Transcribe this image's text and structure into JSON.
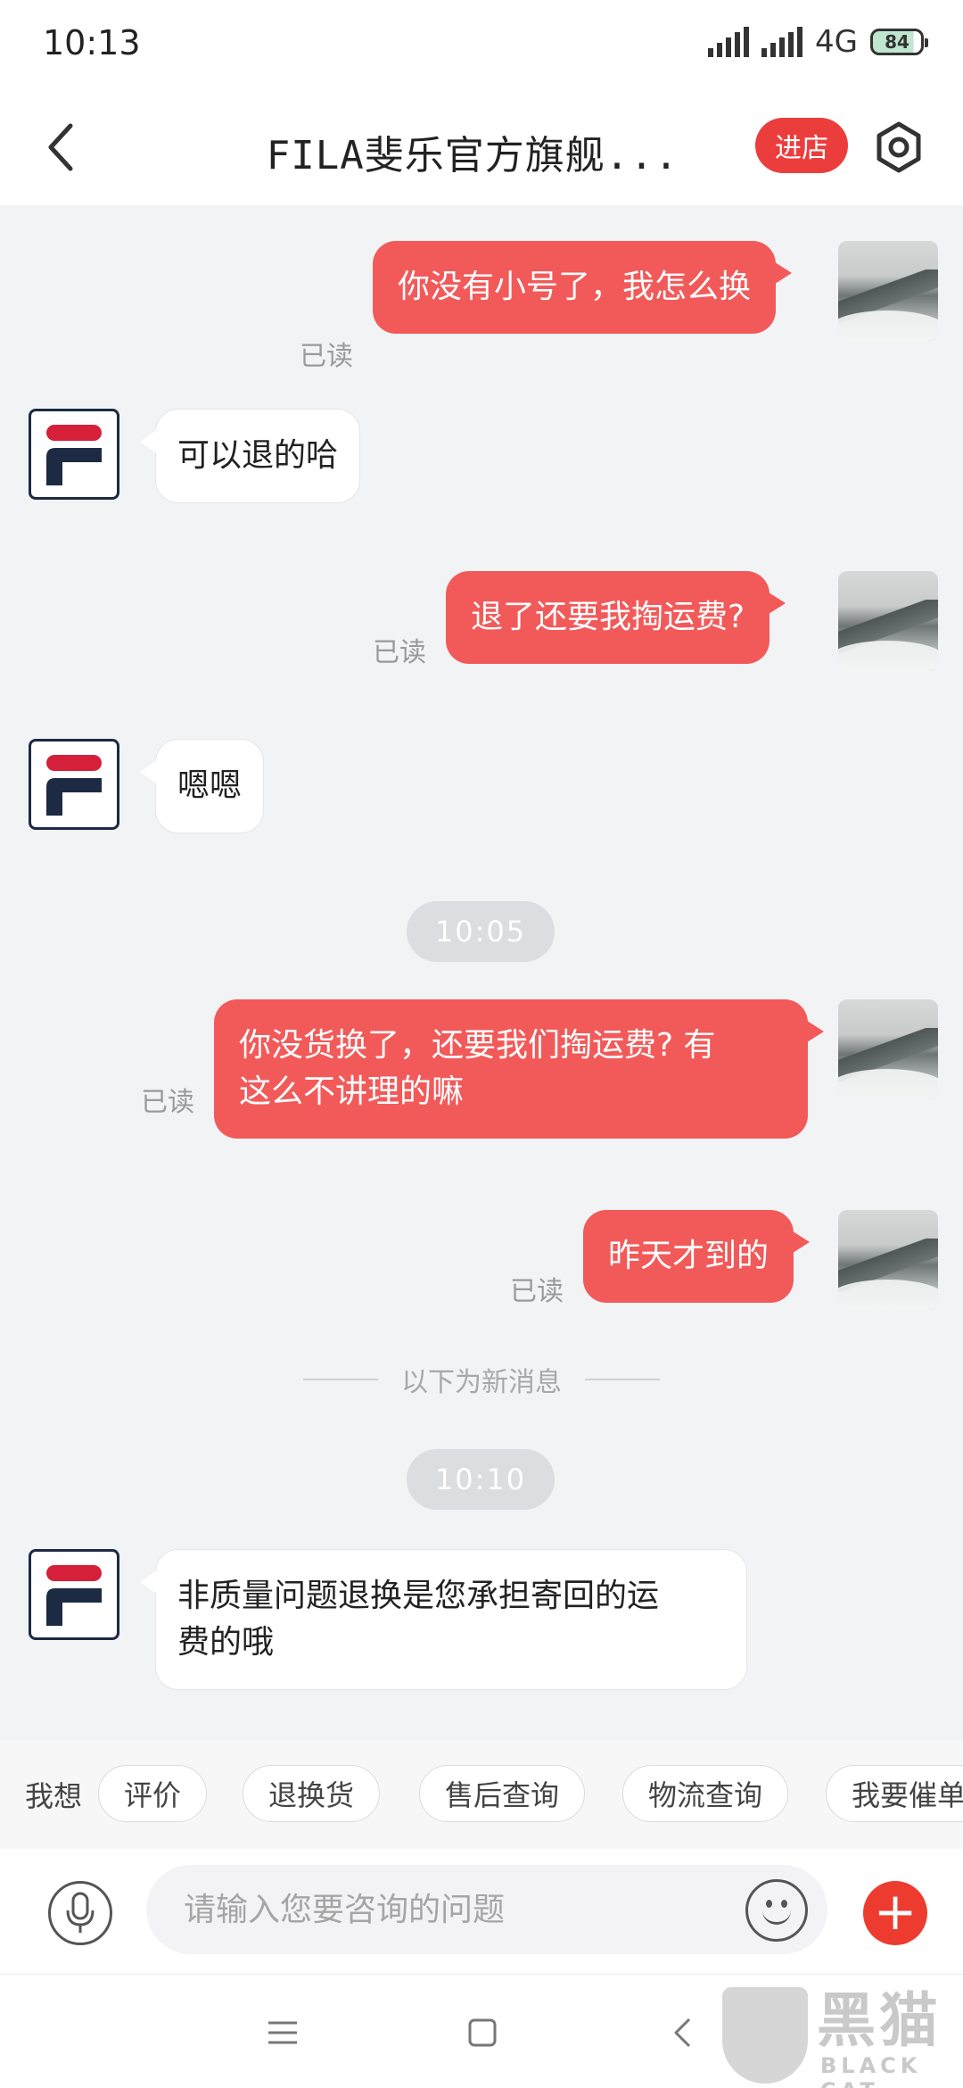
{
  "status_bar": {
    "time": "10:13",
    "network": "4G",
    "battery": "84"
  },
  "header": {
    "title": "FILA斐乐官方旗舰...",
    "enter_store": "进店"
  },
  "messages": [
    {
      "from": "me",
      "text": "你没有小号了，我怎么换",
      "read": "已读"
    },
    {
      "from": "shop",
      "text": "可以退的哈"
    },
    {
      "from": "me",
      "text": "退了还要我掏运费?",
      "read": "已读"
    },
    {
      "from": "shop",
      "text": "嗯嗯"
    },
    {
      "from": "me",
      "text_line1": "你没货换了，还要我们掏运费? 有",
      "text_line2": "这么不讲理的嘛",
      "read": "已读"
    },
    {
      "from": "me",
      "text": "昨天才到的",
      "read": "已读"
    },
    {
      "from": "shop",
      "text_line1": "非质量问题退换是您承担寄回的运",
      "text_line2": "费的哦"
    }
  ],
  "timestamps": [
    "10:05",
    "10:10"
  ],
  "new_messages_divider": "以下为新消息",
  "quick_actions": {
    "label": "我想",
    "chips": [
      "评价",
      "退换货",
      "售后查询",
      "物流查询",
      "我要催单"
    ]
  },
  "input": {
    "placeholder": "请输入您要咨询的问题"
  },
  "watermark": {
    "cn": "黑猫",
    "en": "BLACK CAT"
  },
  "colors": {
    "accent": "#ec3d3d",
    "my_bubble": "#f25a5a",
    "background": "#f2f3f5"
  }
}
